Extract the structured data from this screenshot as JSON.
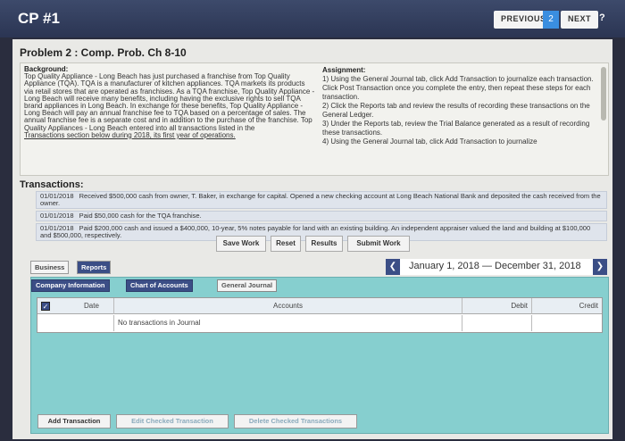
{
  "header": {
    "title": "CP #1",
    "previous_label": "PREVIOUS",
    "page_number": "2",
    "next_label": "NEXT",
    "help_label": "?"
  },
  "problem": {
    "title": "Problem 2 : Comp. Prob. Ch 8-10"
  },
  "background": {
    "label": "Background:",
    "text": "Top Quality Appliance - Long Beach has just purchased a franchise from Top Quality Appliance (TQA). TQA is a manufacturer of kitchen appliances. TQA markets its products via retail stores that are operated as franchises. As a TQA franchise, Top Quality Appliance - Long Beach will receive many benefits, including having the exclusive rights to sell TQA brand appliances in Long Beach. In exchange for these benefits, Top Quality Appliance - Long Beach will pay an annual franchise fee to TQA based on a percentage of sales. The annual franchise fee is a separate cost and in addition to the purchase of the franchise. Top Quality Appliances - Long Beach entered into all transactions listed in the",
    "link_text": "Transactions section below during 2018, its first year of operations."
  },
  "assignment": {
    "label": "Assignment:",
    "steps": [
      "1) Using the General Journal tab, click Add Transaction to journalize each transaction. Click Post Transaction once you complete the entry, then repeat these steps for each transaction.",
      "2) Click the Reports tab and review the results of recording these transactions on the General Ledger.",
      "3) Under the Reports tab, review the Trial Balance generated as a result of recording these transactions.",
      "4) Using the General Journal tab, click Add Transaction to journalize"
    ]
  },
  "transactions": {
    "label": "Transactions:",
    "items": [
      {
        "date": "01/01/2018",
        "text": "Received $500,000 cash from owner, T. Baker, in exchange for capital. Opened a new checking account at Long Beach National Bank and deposited the cash received from the owner."
      },
      {
        "date": "01/01/2018",
        "text": "Paid $50,000 cash for the TQA franchise."
      },
      {
        "date": "01/01/2018",
        "text": "Paid $200,000 cash and issued a $400,000, 10-year, 5% notes payable for land with an existing building. An independent appraiser valued the land and building at $100,000 and $500,000, respectively."
      }
    ]
  },
  "actions": {
    "save": "Save Work",
    "reset": "Reset",
    "results": "Results",
    "submit": "Submit Work"
  },
  "tabs": {
    "business": "Business",
    "reports": "Reports"
  },
  "date_range": {
    "text": "January 1, 2018 — December 31, 2018"
  },
  "subtabs": {
    "company_info": "Company Information",
    "chart_of_accounts": "Chart of Accounts",
    "general_journal": "General Journal"
  },
  "journal": {
    "columns": {
      "date": "Date",
      "accounts": "Accounts",
      "debit": "Debit",
      "credit": "Credit"
    },
    "empty_message": "No transactions in Journal"
  },
  "bottom_actions": {
    "add": "Add Transaction",
    "edit": "Edit Checked Transaction",
    "delete": "Delete Checked Transactions"
  }
}
